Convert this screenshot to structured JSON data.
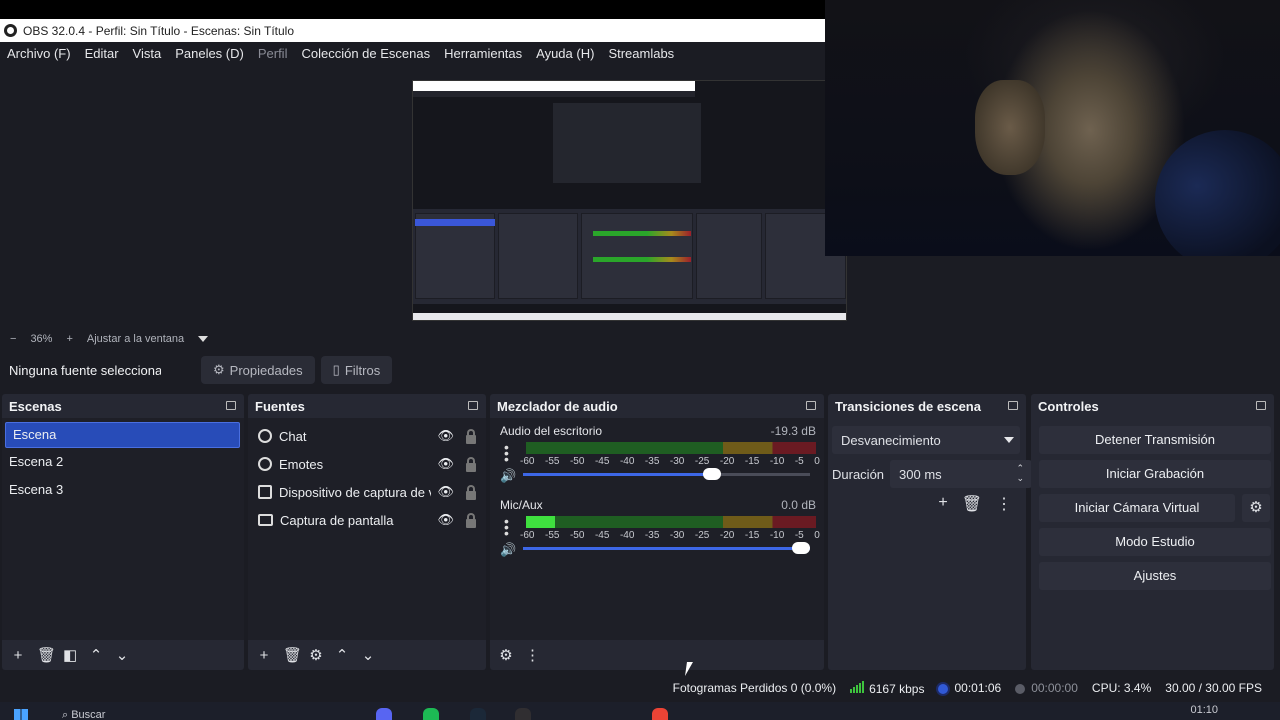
{
  "window": {
    "title": "OBS 32.0.4 - Perfil: Sin Título - Escenas: Sin Título"
  },
  "menu": [
    {
      "label": "Archivo (F)",
      "enabled": true
    },
    {
      "label": "Editar",
      "enabled": true
    },
    {
      "label": "Vista",
      "enabled": true
    },
    {
      "label": "Paneles (D)",
      "enabled": true
    },
    {
      "label": "Perfil",
      "enabled": false
    },
    {
      "label": "Colección de Escenas",
      "enabled": true
    },
    {
      "label": "Herramientas",
      "enabled": true
    },
    {
      "label": "Ayuda (H)",
      "enabled": true
    },
    {
      "label": "Streamlabs",
      "enabled": true
    }
  ],
  "zoom": {
    "minus": "−",
    "value": "36%",
    "plus": "+",
    "fit_label": "Ajustar a la ventana"
  },
  "source_bar": {
    "no_source": "Ninguna fuente seleccionada",
    "properties": "Propiedades",
    "filters": "Filtros"
  },
  "scenes": {
    "title": "Escenas",
    "items": [
      "Escena",
      "Escena 2",
      "Escena 3"
    ],
    "selected": 0
  },
  "sources": {
    "title": "Fuentes",
    "items": [
      {
        "name": "Chat",
        "icon": "browser-icon"
      },
      {
        "name": "Emotes",
        "icon": "browser-icon"
      },
      {
        "name": "Dispositivo de captura de video",
        "icon": "camera-icon"
      },
      {
        "name": "Captura de pantalla",
        "icon": "monitor-icon"
      }
    ]
  },
  "mixer": {
    "title": "Mezclador de audio",
    "ticks": [
      "-60",
      "-55",
      "-50",
      "-45",
      "-40",
      "-35",
      "-30",
      "-25",
      "-20",
      "-15",
      "-10",
      "-5",
      "0"
    ],
    "channels": [
      {
        "name": "Audio del escritorio",
        "db": "-19.3 dB",
        "level": 0.0,
        "volume": 0.66
      },
      {
        "name": "Mic/Aux",
        "db": "0.0 dB",
        "level": 0.1,
        "volume": 1.0
      }
    ]
  },
  "transitions": {
    "title": "Transiciones de escena",
    "selected": "Desvanecimiento",
    "duration_label": "Duración",
    "duration_value": "300 ms"
  },
  "controls": {
    "title": "Controles",
    "stop_stream": "Detener Transmisión",
    "start_recording": "Iniciar Grabación",
    "start_virtual_cam": "Iniciar Cámara Virtual",
    "studio_mode": "Modo Estudio",
    "settings": "Ajustes"
  },
  "status": {
    "dropped_frames": "Fotogramas Perdidos 0 (0.0%)",
    "bitrate": "6167 kbps",
    "stream_time": "00:01:06",
    "rec_time": "00:00:00",
    "cpu": "CPU: 3.4%",
    "fps": "30.00 / 30.00 FPS"
  },
  "taskbar": {
    "search": "Buscar",
    "clock": "01:10"
  },
  "colors": {
    "accent": "#284cb8",
    "panel": "#262833",
    "background": "#1b1c23",
    "meter_green": "#3fe03f"
  }
}
